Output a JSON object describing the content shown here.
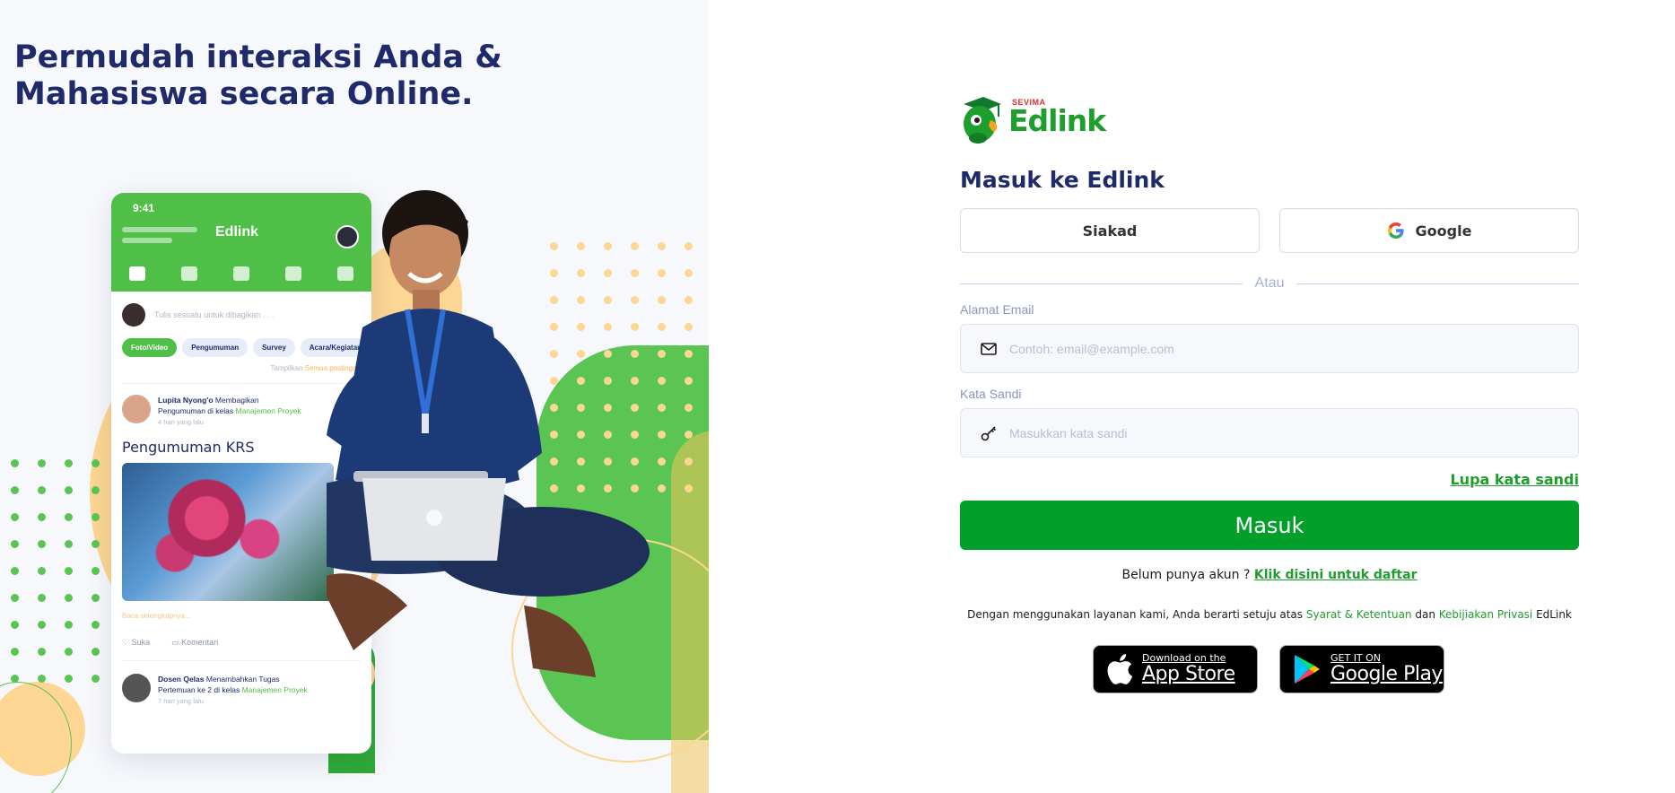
{
  "hero": {
    "headline": "Permudah interaksi Anda & Mahasiswa secara Online."
  },
  "phone": {
    "time": "9:41",
    "brand": "Edlink",
    "post_placeholder": "Tulis sesuatu untuk dibagikan . . .",
    "chips": [
      "Foto/Video",
      "Pengumuman",
      "Survey",
      "Acara/Kegiatan"
    ],
    "show_prefix": "Tampilkan",
    "show_link": "Semua postingan",
    "post1": {
      "author": "Lupita Nyong'o",
      "action": "Membagikan",
      "line2_prefix": "Pengumuman di kelas",
      "class_name": "Manajemen Proyek",
      "time": "4 hari yang lalu",
      "title": "Pengumuman KRS",
      "read_more": "Baca selengkapnya...",
      "like": "Suka",
      "comment": "Komentari"
    },
    "post2": {
      "author": "Dosen Qelas",
      "action": "Menambahkan Tugas",
      "line2_prefix": "Pertemuan ke 2 di kelas",
      "class_name": "Manajemen Proyek",
      "time": "7 hari yang lalu"
    }
  },
  "login": {
    "logo_small": "SEVIMA",
    "logo_word": "Edlink",
    "title": "Masuk ke Edlink",
    "siakad_label": "Siakad",
    "google_label": "Google",
    "divider": "Atau",
    "email_label": "Alamat Email",
    "email_placeholder": "Contoh: email@example.com",
    "password_label": "Kata Sandi",
    "password_placeholder": "Masukkan kata sandi",
    "forgot": "Lupa kata sandi",
    "submit": "Masuk",
    "register_prefix": "Belum punya akun ?",
    "register_link": "Klik disini untuk daftar",
    "terms_prefix": "Dengan menggunakan layanan kami, Anda berarti setuju atas",
    "terms_link": "Syarat & Ketentuan",
    "terms_mid": "dan",
    "privacy_link": "Kebijiakan Privasi",
    "terms_suffix": "EdLink"
  },
  "stores": {
    "apple_small": "Download on the",
    "apple_big": "App Store",
    "google_small": "GET IT ON",
    "google_big": "Google Play"
  },
  "colors": {
    "brand_green": "#02a02a",
    "navy": "#1f2a6b",
    "accent_orange": "#fbd38d"
  }
}
